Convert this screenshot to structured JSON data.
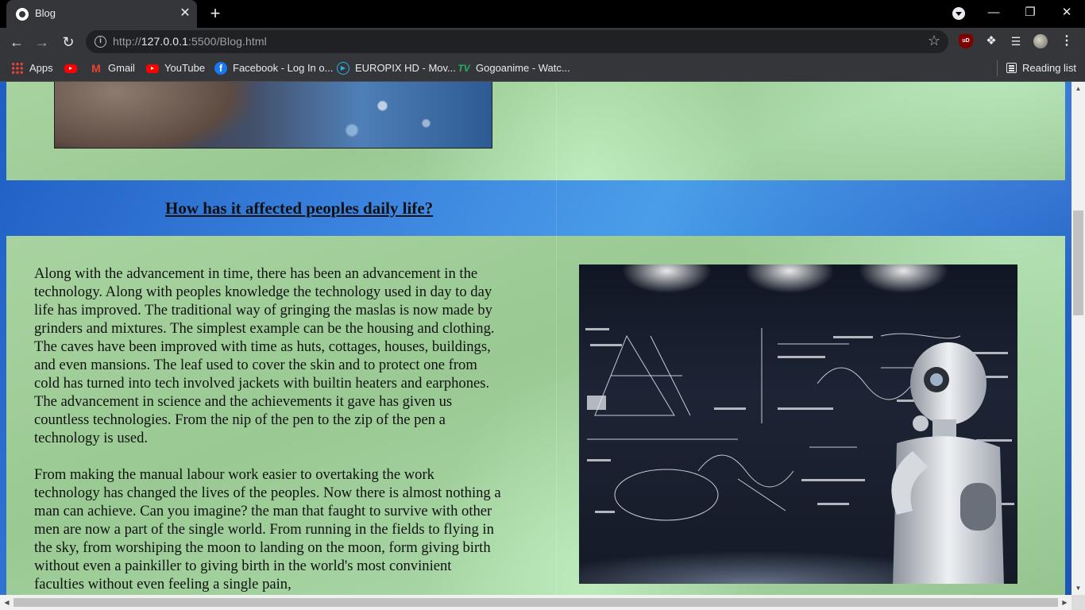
{
  "browser": {
    "tab_title": "Blog",
    "tab_close": "✕",
    "new_tab": "+",
    "window_controls": {
      "minimize": "—",
      "restore": "❐",
      "close": "✕"
    },
    "url_scheme": "http://",
    "url_host": "127.0.0.1",
    "url_rest": ":5500/Blog.html",
    "bookmarks": [
      {
        "label": "Apps",
        "icon": "apps-grid-icon"
      },
      {
        "label": "",
        "icon": "youtube-icon"
      },
      {
        "label": "Gmail",
        "icon": "gmail-icon"
      },
      {
        "label": "YouTube",
        "icon": "youtube-icon"
      },
      {
        "label": "Facebook - Log In o...",
        "icon": "facebook-icon"
      },
      {
        "label": "EUROPIX HD - Mov...",
        "icon": "europix-icon"
      },
      {
        "label": "Gogoanime - Watc...",
        "icon": "gogoanime-icon"
      }
    ],
    "reading_list": "Reading list",
    "extensions": {
      "ublock_badge": "uD"
    }
  },
  "page": {
    "section_heading": "How has it affected peoples daily life?",
    "paragraphs": [
      "Along with the advancement in time, there has been an advancement in the technology. Along with peoples knowledge the technology used in day to day life has improved. The traditional way of gringing the maslas is now made by grinders and mixtures. The simplest example can be the housing and clothing. The caves have been improved with time as huts, cottages, houses, buildings, and even mansions. The leaf used to cover the skin and to protect one from cold has turned into tech involved jackets with builtin heaters and earphones. The advancement in science and the achievements it gave has given us countless technologies. From the nip of the pen to the zip of the pen a technology is used.",
      "From making the manual labour work easier to overtaking the work technology has changed the lives of the peoples. Now there is almost nothing a man can achieve. Can you imagine? the man that faught to survive with other men are now a part of the single world. From running in the fields to flying in the sky, from worshiping the moon to landing on the moon, form giving birth without even a painkiller to giving birth in the world's most convinient faculties without even feeling a single pain,"
    ]
  },
  "colors": {
    "page_blue": "#3d86e0",
    "panel_green": "#a8d3a0",
    "text": "#111111",
    "chrome_dark": "#35363a"
  }
}
